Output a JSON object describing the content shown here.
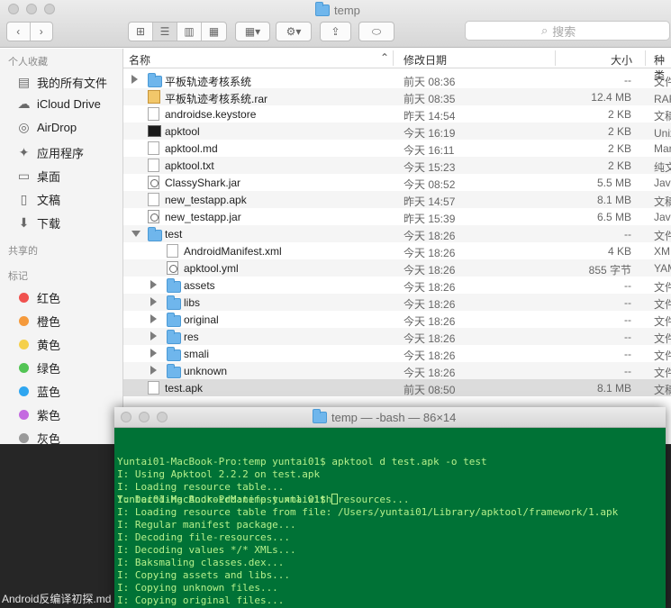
{
  "finder": {
    "title": "temp",
    "search_placeholder": "搜索",
    "sidebar": {
      "favorites_header": "个人收藏",
      "favorites": [
        {
          "label": "我的所有文件",
          "icon": "all-files-icon",
          "glyph": "▤"
        },
        {
          "label": "iCloud Drive",
          "icon": "cloud-icon",
          "glyph": "☁"
        },
        {
          "label": "AirDrop",
          "icon": "airdrop-icon",
          "glyph": "◎"
        },
        {
          "label": "应用程序",
          "icon": "applications-icon",
          "glyph": "✦"
        },
        {
          "label": "桌面",
          "icon": "desktop-icon",
          "glyph": "▭"
        },
        {
          "label": "文稿",
          "icon": "documents-icon",
          "glyph": "▯"
        },
        {
          "label": "下载",
          "icon": "downloads-icon",
          "glyph": "⬇"
        }
      ],
      "shared_header": "共享的",
      "tags_header": "标记",
      "tags": [
        {
          "label": "红色",
          "color": "#f0524f"
        },
        {
          "label": "橙色",
          "color": "#f59a3c"
        },
        {
          "label": "黄色",
          "color": "#f5d04a"
        },
        {
          "label": "绿色",
          "color": "#52c454"
        },
        {
          "label": "蓝色",
          "color": "#2fa6f0"
        },
        {
          "label": "紫色",
          "color": "#c46be0"
        },
        {
          "label": "灰色",
          "color": "#9a9a9a"
        }
      ]
    },
    "columns": {
      "name": "名称",
      "date": "修改日期",
      "size": "大小",
      "kind": "种类"
    },
    "rows": [
      {
        "name": "平板轨迹考核系统",
        "date": "前天 08:36",
        "size": "--",
        "kind": "文件夹",
        "type": "folder",
        "depth": 0,
        "disclosure": "closed"
      },
      {
        "name": "平板轨迹考核系统.rar",
        "date": "前天 08:35",
        "size": "12.4 MB",
        "kind": "RAR 归档",
        "type": "rar",
        "depth": 0,
        "disclosure": "none"
      },
      {
        "name": "androidse.keystore",
        "date": "昨天 14:54",
        "size": "2 KB",
        "kind": "文稿",
        "type": "file",
        "depth": 0,
        "disclosure": "none"
      },
      {
        "name": "apktool",
        "date": "今天 16:19",
        "size": "2 KB",
        "kind": "Unix 可执行文件",
        "type": "terminal",
        "depth": 0,
        "disclosure": "none"
      },
      {
        "name": "apktool.md",
        "date": "今天 16:11",
        "size": "2 KB",
        "kind": "Markdown",
        "type": "file",
        "depth": 0,
        "disclosure": "none"
      },
      {
        "name": "apktool.txt",
        "date": "今天 15:23",
        "size": "2 KB",
        "kind": "纯文本",
        "type": "file",
        "depth": 0,
        "disclosure": "none"
      },
      {
        "name": "ClassyShark.jar",
        "date": "今天 08:52",
        "size": "5.5 MB",
        "kind": "Java JAR",
        "type": "jar",
        "depth": 0,
        "disclosure": "none"
      },
      {
        "name": "new_testapp.apk",
        "date": "昨天 14:57",
        "size": "8.1 MB",
        "kind": "文稿",
        "type": "file",
        "depth": 0,
        "disclosure": "none"
      },
      {
        "name": "new_testapp.jar",
        "date": "昨天 15:39",
        "size": "6.5 MB",
        "kind": "Java JAR",
        "type": "jar",
        "depth": 0,
        "disclosure": "none"
      },
      {
        "name": "test",
        "date": "今天 18:26",
        "size": "--",
        "kind": "文件夹",
        "type": "folder",
        "depth": 0,
        "disclosure": "open"
      },
      {
        "name": "AndroidManifest.xml",
        "date": "今天 18:26",
        "size": "4 KB",
        "kind": "XML",
        "type": "file",
        "depth": 1,
        "disclosure": "none"
      },
      {
        "name": "apktool.yml",
        "date": "今天 18:26",
        "size": "855 字节",
        "kind": "YAML",
        "type": "jar",
        "depth": 1,
        "disclosure": "none"
      },
      {
        "name": "assets",
        "date": "今天 18:26",
        "size": "--",
        "kind": "文件夹",
        "type": "folder",
        "depth": 1,
        "disclosure": "closed"
      },
      {
        "name": "libs",
        "date": "今天 18:26",
        "size": "--",
        "kind": "文件夹",
        "type": "folder",
        "depth": 1,
        "disclosure": "closed"
      },
      {
        "name": "original",
        "date": "今天 18:26",
        "size": "--",
        "kind": "文件夹",
        "type": "folder",
        "depth": 1,
        "disclosure": "closed"
      },
      {
        "name": "res",
        "date": "今天 18:26",
        "size": "--",
        "kind": "文件夹",
        "type": "folder",
        "depth": 1,
        "disclosure": "closed"
      },
      {
        "name": "smali",
        "date": "今天 18:26",
        "size": "--",
        "kind": "文件夹",
        "type": "folder",
        "depth": 1,
        "disclosure": "closed"
      },
      {
        "name": "unknown",
        "date": "今天 18:26",
        "size": "--",
        "kind": "文件夹",
        "type": "folder",
        "depth": 1,
        "disclosure": "closed"
      },
      {
        "name": "test.apk",
        "date": "前天 08:50",
        "size": "8.1 MB",
        "kind": "文稿",
        "type": "file",
        "depth": 0,
        "disclosure": "none",
        "selected": true
      }
    ]
  },
  "terminal": {
    "title": "temp — -bash — 86×14",
    "lines": [
      "Yuntai01-MacBook-Pro:temp yuntai01$ apktool d test.apk -o test",
      "I: Using Apktool 2.2.2 on test.apk",
      "I: Loading resource table...",
      "I: Decoding AndroidManifest.xml with resources...",
      "I: Loading resource table from file: /Users/yuntai01/Library/apktool/framework/1.apk",
      "I: Regular manifest package...",
      "I: Decoding file-resources...",
      "I: Decoding values */* XMLs...",
      "I: Baksmaling classes.dex...",
      "I: Copying assets and libs...",
      "I: Copying unknown files...",
      "I: Copying original files..."
    ],
    "prompt": "Yuntai01-MacBook-Pro:temp yuntai01$ "
  },
  "desktop": {
    "label": "Android反编译初探.md"
  }
}
